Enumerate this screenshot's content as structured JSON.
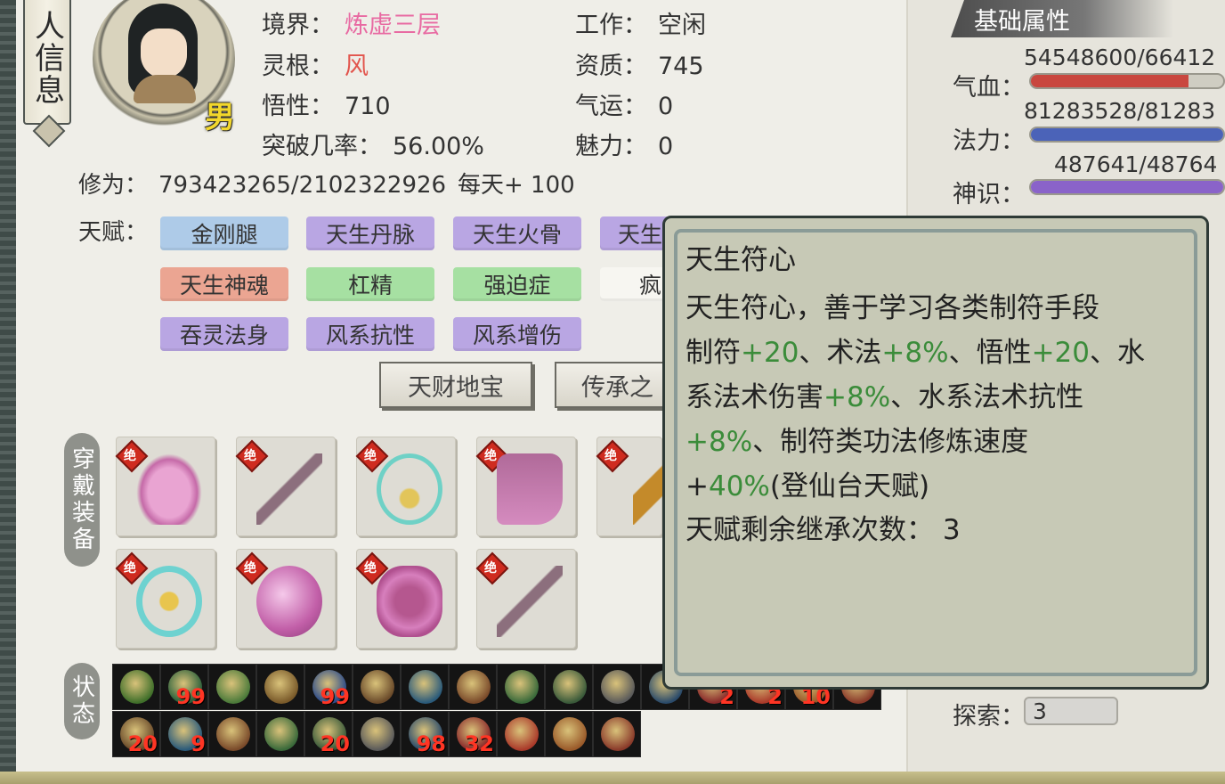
{
  "header": {
    "title": "人信息",
    "gender": "男"
  },
  "info": {
    "realm_label": "境界：",
    "realm_value": "炼虚三层",
    "work_label": "工作：",
    "work_value": "空闲",
    "root_label": "灵根：",
    "root_value": "风",
    "aptitude_label": "资质：",
    "aptitude_value": "745",
    "comprehension_label": "悟性：",
    "comprehension_value": "710",
    "luck_label": "气运：",
    "luck_value": "0",
    "breakthrough_label": "突破几率：",
    "breakthrough_value": "56.00%",
    "charm_label": "魅力：",
    "charm_value": "0",
    "cultivation_label": "修为：",
    "cultivation_value": "793423265/2102322926",
    "daily_label": "每天+ 100"
  },
  "talents": {
    "label": "天赋：",
    "items": [
      "金刚腿",
      "天生丹脉",
      "天生火骨",
      "天生",
      "天生神魂",
      "杠精",
      "强迫症",
      "疯",
      "吞灵法身",
      "风系抗性",
      "风系增伤"
    ]
  },
  "buttons": {
    "treasure": "天财地宝",
    "inherit": "传承之"
  },
  "sections": {
    "equipment": "穿戴装备",
    "status": "状态",
    "tier_mark": "绝"
  },
  "status_counts": {
    "row1": [
      "",
      "99",
      "",
      "",
      "99",
      "",
      "",
      "",
      "",
      "",
      "",
      "",
      "2",
      "2",
      "10",
      ""
    ],
    "row2": [
      "20",
      "9",
      "",
      "",
      "20",
      "",
      "98",
      "32",
      "",
      "",
      ""
    ]
  },
  "attributes": {
    "title": "基础属性",
    "hp_label": "气血：",
    "hp_value": "54548600/66412",
    "mp_label": "法力：",
    "mp_value": "81283528/81283",
    "sense_label": "神识：",
    "sense_value": "487641/48764",
    "explore_label": "探索：",
    "explore_value": "3",
    "hp_ratio": 0.82,
    "mp_ratio": 1.0,
    "sense_ratio": 1.0,
    "colors": {
      "hp": "#c9473f",
      "mp": "#4b63b8",
      "sense": "#8a63c9"
    }
  },
  "tooltip": {
    "name": "天生符心",
    "desc": "天生符心，善于学习各类制符手段",
    "l2a": "制符",
    "l2b": "+20",
    "l2c": "、术法",
    "l2d": "+8%",
    "l2e": "、悟性",
    "l2f": "+20",
    "l2g": "、水",
    "l3a": "系法术伤害",
    "l3b": "+8%",
    "l3c": "、水系法术抗性",
    "l4a": "+8%",
    "l4b": "、制符类功法修炼速度",
    "l5a": "+",
    "l5b": "40%",
    "l5c": "(登仙台天赋)",
    "l6": "天赋剩余继承次数：  3"
  }
}
